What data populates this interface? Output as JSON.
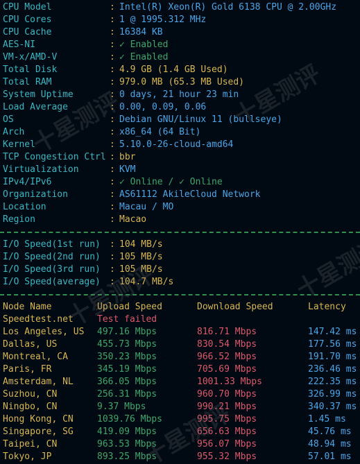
{
  "sysinfo": [
    {
      "label": "CPU Model",
      "value": "Intel(R) Xeon(R) Gold 6138 CPU @ 2.00GHz",
      "color": "blue"
    },
    {
      "label": "CPU Cores",
      "value": "1 @ 1995.312 MHz",
      "color": "blue"
    },
    {
      "label": "CPU Cache",
      "value": "16384 KB",
      "color": "blue"
    },
    {
      "label": "AES-NI",
      "value": "✓ Enabled",
      "color": "green"
    },
    {
      "label": "VM-x/AMD-V",
      "value": "✓ Enabled",
      "color": "green"
    },
    {
      "label": "Total Disk",
      "value": "4.9 GB (1.4 GB Used)",
      "color": "yellow"
    },
    {
      "label": "Total RAM",
      "value": "979.0 MB (65.3 MB Used)",
      "color": "yellow"
    },
    {
      "label": "System Uptime",
      "value": "0 days, 21 hour 23 min",
      "color": "blue"
    },
    {
      "label": "Load Average",
      "value": "0.00, 0.09, 0.06",
      "color": "blue"
    },
    {
      "label": "OS",
      "value": "Debian GNU/Linux 11 (bullseye)",
      "color": "blue"
    },
    {
      "label": "Arch",
      "value": "x86_64 (64 Bit)",
      "color": "blue"
    },
    {
      "label": "Kernel",
      "value": "5.10.0-26-cloud-amd64",
      "color": "blue"
    },
    {
      "label": "TCP Congestion Ctrl",
      "value": "bbr",
      "color": "yellow"
    },
    {
      "label": "Virtualization",
      "value": "KVM",
      "color": "blue"
    },
    {
      "label": "IPv4/IPv6",
      "value": "✓ Online / ✓ Online",
      "color": "green"
    },
    {
      "label": "Organization",
      "value": "AS61112 AkileCloud Network",
      "color": "blue"
    },
    {
      "label": "Location",
      "value": "Macau / MO",
      "color": "blue"
    },
    {
      "label": "Region",
      "value": "Macao",
      "color": "yellow"
    }
  ],
  "io": [
    {
      "label": "I/O Speed(1st run)",
      "value": "104 MB/s"
    },
    {
      "label": "I/O Speed(2nd run)",
      "value": "105 MB/s"
    },
    {
      "label": "I/O Speed(3rd run)",
      "value": "105 MB/s"
    },
    {
      "label": "I/O Speed(average)",
      "value": "104.7 MB/s"
    }
  ],
  "speed": {
    "headers": [
      "Node Name",
      "Upload Speed",
      "Download Speed",
      "Latency"
    ],
    "speedtest": {
      "node": "Speedtest.net",
      "status": "Test failed"
    },
    "rows": [
      {
        "node": "Los Angeles, US",
        "up": "497.16 Mbps",
        "down": "816.71 Mbps",
        "lat": "147.42 ms"
      },
      {
        "node": "Dallas, US",
        "up": "455.73 Mbps",
        "down": "830.54 Mbps",
        "lat": "177.56 ms"
      },
      {
        "node": "Montreal, CA",
        "up": "350.23 Mbps",
        "down": "966.52 Mbps",
        "lat": "191.70 ms"
      },
      {
        "node": "Paris, FR",
        "up": "345.19 Mbps",
        "down": "705.69 Mbps",
        "lat": "236.46 ms"
      },
      {
        "node": "Amsterdam, NL",
        "up": "366.05 Mbps",
        "down": "1001.33 Mbps",
        "lat": "222.35 ms"
      },
      {
        "node": "Suzhou, CN",
        "up": "256.31 Mbps",
        "down": "960.70 Mbps",
        "lat": "326.99 ms"
      },
      {
        "node": "Ningbo, CN",
        "up": "9.37 Mbps",
        "down": "990.21 Mbps",
        "lat": "340.37 ms"
      },
      {
        "node": "Hong Kong, CN",
        "up": "1039.76 Mbps",
        "down": "995.75 Mbps",
        "lat": "1.45 ms"
      },
      {
        "node": "Singapore, SG",
        "up": "419.09 Mbps",
        "down": "656.63 Mbps",
        "lat": "45.76 ms"
      },
      {
        "node": "Taipei, CN",
        "up": "963.53 Mbps",
        "down": "956.07 Mbps",
        "lat": "48.94 ms"
      },
      {
        "node": "Tokyo, JP",
        "up": "893.25 Mbps",
        "down": "955.32 Mbps",
        "lat": "57.01 ms"
      }
    ]
  },
  "watermark": "十星测评",
  "colors": {
    "background": "#010a13",
    "label": "#39b7c2",
    "value_blue": "#4aa6e8",
    "value_yellow": "#d9b650",
    "value_green": "#3fa66b",
    "value_red": "#e0576b",
    "separator": "#2f8f4f"
  }
}
